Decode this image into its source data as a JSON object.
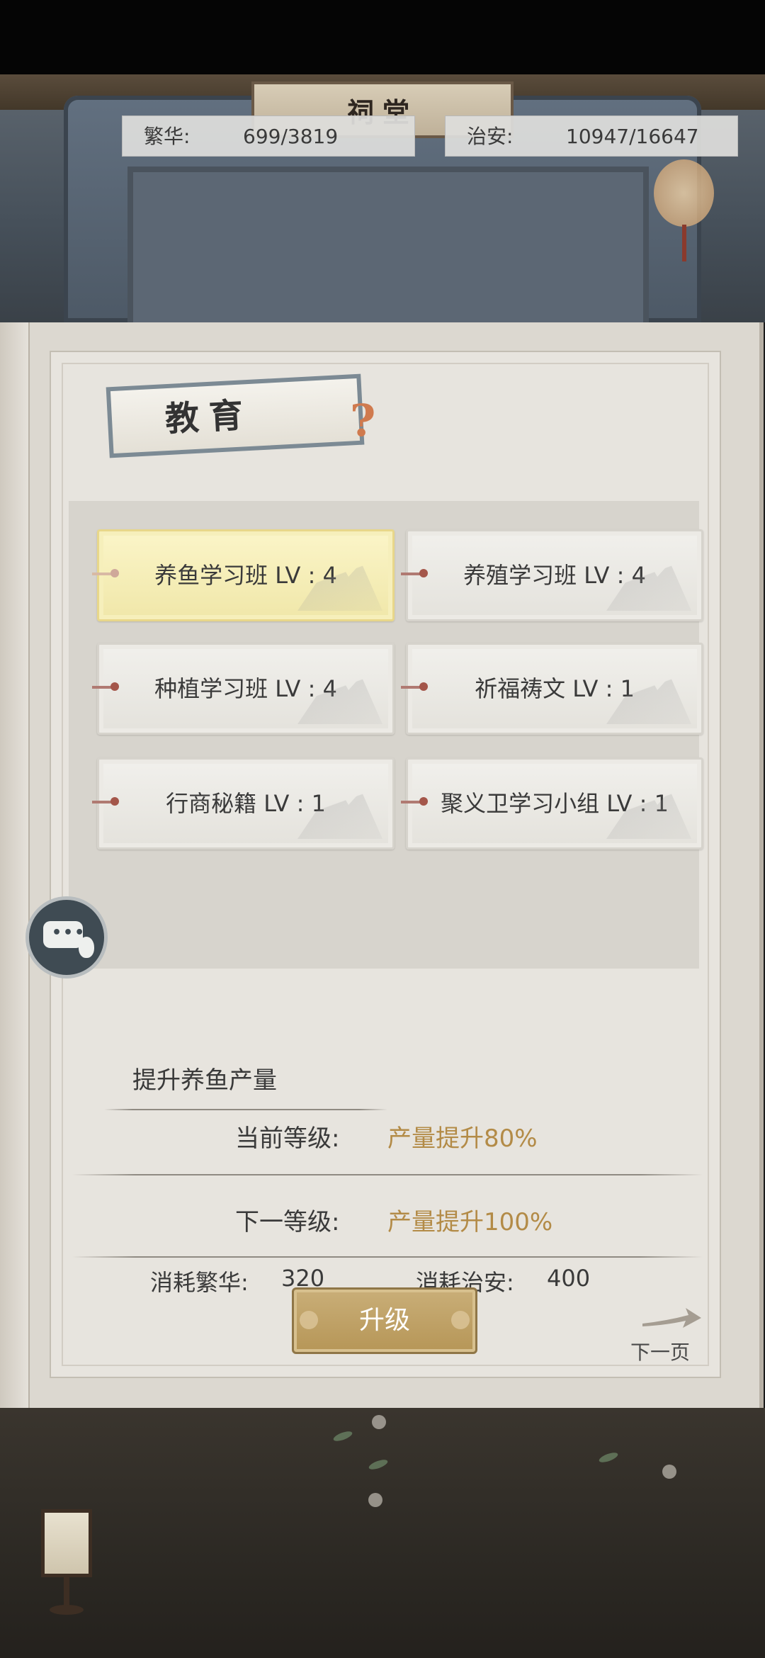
{
  "scene": {
    "plaque_text": "祠堂"
  },
  "stats": {
    "prosperity": {
      "label": "繁华:",
      "value": "699/3819"
    },
    "security": {
      "label": "治安:",
      "value": "10947/16647"
    }
  },
  "panel": {
    "title": "教育",
    "help": "?",
    "courses": [
      {
        "name": "养鱼学习班 LV : 4",
        "selected": true
      },
      {
        "name": "养殖学习班 LV : 4",
        "selected": false
      },
      {
        "name": "种植学习班 LV : 4",
        "selected": false
      },
      {
        "name": "祈福祷文 LV : 1",
        "selected": false
      },
      {
        "name": "行商秘籍 LV : 1",
        "selected": false
      },
      {
        "name": "聚义卫学习小组 LV : 1",
        "selected": false
      }
    ],
    "detail": {
      "description": "提升养鱼产量",
      "current_label": "当前等级:",
      "current_value": "产量提升80%",
      "next_label": "下一等级:",
      "next_value": "产量提升100%",
      "cost_prosperity_label": "消耗繁华:",
      "cost_prosperity_value": "320",
      "cost_security_label": "消耗治安:",
      "cost_security_value": "400"
    },
    "upgrade_label": "升级",
    "next_page_label": "下一页"
  },
  "colors": {
    "accent_gold": "#b38b47",
    "button_gold": "#c9ae78",
    "selected_card": "#fbf5c8"
  },
  "icons": [
    "chat-bubble-icon",
    "help-icon",
    "next-arrow-icon",
    "lamp-icon"
  ]
}
